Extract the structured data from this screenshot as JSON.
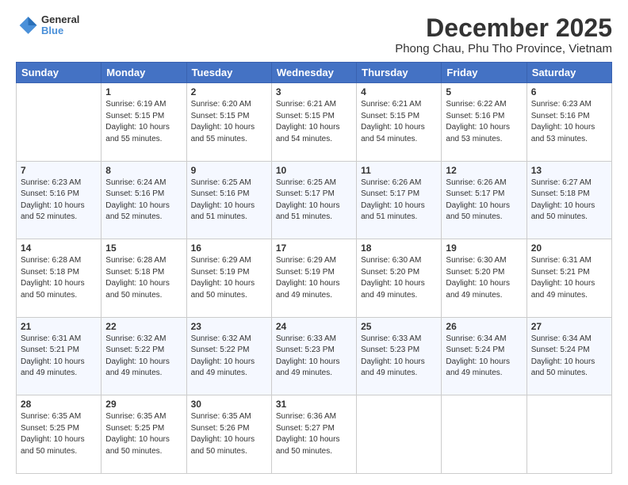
{
  "logo": {
    "line1": "General",
    "line2": "Blue"
  },
  "title": "December 2025",
  "subtitle": "Phong Chau, Phu Tho Province, Vietnam",
  "header": {
    "days": [
      "Sunday",
      "Monday",
      "Tuesday",
      "Wednesday",
      "Thursday",
      "Friday",
      "Saturday"
    ]
  },
  "weeks": [
    [
      {
        "day": "",
        "sunrise": "",
        "sunset": "",
        "daylight": ""
      },
      {
        "day": "1",
        "sunrise": "Sunrise: 6:19 AM",
        "sunset": "Sunset: 5:15 PM",
        "daylight": "Daylight: 10 hours and 55 minutes."
      },
      {
        "day": "2",
        "sunrise": "Sunrise: 6:20 AM",
        "sunset": "Sunset: 5:15 PM",
        "daylight": "Daylight: 10 hours and 55 minutes."
      },
      {
        "day": "3",
        "sunrise": "Sunrise: 6:21 AM",
        "sunset": "Sunset: 5:15 PM",
        "daylight": "Daylight: 10 hours and 54 minutes."
      },
      {
        "day": "4",
        "sunrise": "Sunrise: 6:21 AM",
        "sunset": "Sunset: 5:15 PM",
        "daylight": "Daylight: 10 hours and 54 minutes."
      },
      {
        "day": "5",
        "sunrise": "Sunrise: 6:22 AM",
        "sunset": "Sunset: 5:16 PM",
        "daylight": "Daylight: 10 hours and 53 minutes."
      },
      {
        "day": "6",
        "sunrise": "Sunrise: 6:23 AM",
        "sunset": "Sunset: 5:16 PM",
        "daylight": "Daylight: 10 hours and 53 minutes."
      }
    ],
    [
      {
        "day": "7",
        "sunrise": "Sunrise: 6:23 AM",
        "sunset": "Sunset: 5:16 PM",
        "daylight": "Daylight: 10 hours and 52 minutes."
      },
      {
        "day": "8",
        "sunrise": "Sunrise: 6:24 AM",
        "sunset": "Sunset: 5:16 PM",
        "daylight": "Daylight: 10 hours and 52 minutes."
      },
      {
        "day": "9",
        "sunrise": "Sunrise: 6:25 AM",
        "sunset": "Sunset: 5:16 PM",
        "daylight": "Daylight: 10 hours and 51 minutes."
      },
      {
        "day": "10",
        "sunrise": "Sunrise: 6:25 AM",
        "sunset": "Sunset: 5:17 PM",
        "daylight": "Daylight: 10 hours and 51 minutes."
      },
      {
        "day": "11",
        "sunrise": "Sunrise: 6:26 AM",
        "sunset": "Sunset: 5:17 PM",
        "daylight": "Daylight: 10 hours and 51 minutes."
      },
      {
        "day": "12",
        "sunrise": "Sunrise: 6:26 AM",
        "sunset": "Sunset: 5:17 PM",
        "daylight": "Daylight: 10 hours and 50 minutes."
      },
      {
        "day": "13",
        "sunrise": "Sunrise: 6:27 AM",
        "sunset": "Sunset: 5:18 PM",
        "daylight": "Daylight: 10 hours and 50 minutes."
      }
    ],
    [
      {
        "day": "14",
        "sunrise": "Sunrise: 6:28 AM",
        "sunset": "Sunset: 5:18 PM",
        "daylight": "Daylight: 10 hours and 50 minutes."
      },
      {
        "day": "15",
        "sunrise": "Sunrise: 6:28 AM",
        "sunset": "Sunset: 5:18 PM",
        "daylight": "Daylight: 10 hours and 50 minutes."
      },
      {
        "day": "16",
        "sunrise": "Sunrise: 6:29 AM",
        "sunset": "Sunset: 5:19 PM",
        "daylight": "Daylight: 10 hours and 50 minutes."
      },
      {
        "day": "17",
        "sunrise": "Sunrise: 6:29 AM",
        "sunset": "Sunset: 5:19 PM",
        "daylight": "Daylight: 10 hours and 49 minutes."
      },
      {
        "day": "18",
        "sunrise": "Sunrise: 6:30 AM",
        "sunset": "Sunset: 5:20 PM",
        "daylight": "Daylight: 10 hours and 49 minutes."
      },
      {
        "day": "19",
        "sunrise": "Sunrise: 6:30 AM",
        "sunset": "Sunset: 5:20 PM",
        "daylight": "Daylight: 10 hours and 49 minutes."
      },
      {
        "day": "20",
        "sunrise": "Sunrise: 6:31 AM",
        "sunset": "Sunset: 5:21 PM",
        "daylight": "Daylight: 10 hours and 49 minutes."
      }
    ],
    [
      {
        "day": "21",
        "sunrise": "Sunrise: 6:31 AM",
        "sunset": "Sunset: 5:21 PM",
        "daylight": "Daylight: 10 hours and 49 minutes."
      },
      {
        "day": "22",
        "sunrise": "Sunrise: 6:32 AM",
        "sunset": "Sunset: 5:22 PM",
        "daylight": "Daylight: 10 hours and 49 minutes."
      },
      {
        "day": "23",
        "sunrise": "Sunrise: 6:32 AM",
        "sunset": "Sunset: 5:22 PM",
        "daylight": "Daylight: 10 hours and 49 minutes."
      },
      {
        "day": "24",
        "sunrise": "Sunrise: 6:33 AM",
        "sunset": "Sunset: 5:23 PM",
        "daylight": "Daylight: 10 hours and 49 minutes."
      },
      {
        "day": "25",
        "sunrise": "Sunrise: 6:33 AM",
        "sunset": "Sunset: 5:23 PM",
        "daylight": "Daylight: 10 hours and 49 minutes."
      },
      {
        "day": "26",
        "sunrise": "Sunrise: 6:34 AM",
        "sunset": "Sunset: 5:24 PM",
        "daylight": "Daylight: 10 hours and 49 minutes."
      },
      {
        "day": "27",
        "sunrise": "Sunrise: 6:34 AM",
        "sunset": "Sunset: 5:24 PM",
        "daylight": "Daylight: 10 hours and 50 minutes."
      }
    ],
    [
      {
        "day": "28",
        "sunrise": "Sunrise: 6:35 AM",
        "sunset": "Sunset: 5:25 PM",
        "daylight": "Daylight: 10 hours and 50 minutes."
      },
      {
        "day": "29",
        "sunrise": "Sunrise: 6:35 AM",
        "sunset": "Sunset: 5:25 PM",
        "daylight": "Daylight: 10 hours and 50 minutes."
      },
      {
        "day": "30",
        "sunrise": "Sunrise: 6:35 AM",
        "sunset": "Sunset: 5:26 PM",
        "daylight": "Daylight: 10 hours and 50 minutes."
      },
      {
        "day": "31",
        "sunrise": "Sunrise: 6:36 AM",
        "sunset": "Sunset: 5:27 PM",
        "daylight": "Daylight: 10 hours and 50 minutes."
      },
      {
        "day": "",
        "sunrise": "",
        "sunset": "",
        "daylight": ""
      },
      {
        "day": "",
        "sunrise": "",
        "sunset": "",
        "daylight": ""
      },
      {
        "day": "",
        "sunrise": "",
        "sunset": "",
        "daylight": ""
      }
    ]
  ]
}
